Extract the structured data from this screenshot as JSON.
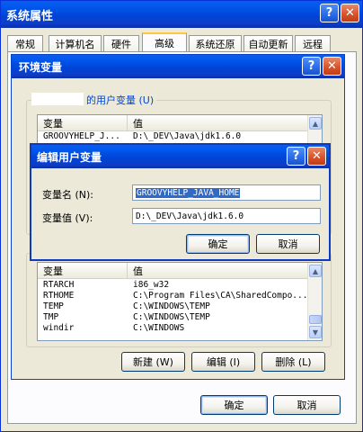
{
  "sysprops": {
    "title": "系统属性",
    "tabs": [
      "常规",
      "计算机名",
      "硬件",
      "高级",
      "系统还原",
      "自动更新",
      "远程"
    ],
    "ok_label": "确定",
    "cancel_label": "取消"
  },
  "envvars": {
    "title": "环境变量",
    "user_section_label": "的用户变量 (U)",
    "columns": [
      "变量",
      "值"
    ],
    "user_vars": [
      {
        "name": "GROOVYHELP_J...",
        "value": "D:\\_DEV\\Java\\jdk1.6.0"
      }
    ],
    "system_vars": [
      {
        "name": "RTARCH",
        "value": "i86_w32"
      },
      {
        "name": "RTHOME",
        "value": "C:\\Program Files\\CA\\SharedCompo..."
      },
      {
        "name": "TEMP",
        "value": "C:\\WINDOWS\\TEMP"
      },
      {
        "name": "TMP",
        "value": "C:\\WINDOWS\\TEMP"
      },
      {
        "name": "windir",
        "value": "C:\\WINDOWS"
      }
    ],
    "new_label": "新建 (W)",
    "edit_label": "编辑 (I)",
    "delete_label": "删除 (L)"
  },
  "editdlg": {
    "title": "编辑用户变量",
    "name_label": "变量名 (N):",
    "value_label": "变量值 (V):",
    "name_value": "GROOVYHELP_JAVA_HOME",
    "value_value": "D:\\_DEV\\Java\\jdk1.6.0",
    "ok_label": "确定",
    "cancel_label": "取消"
  },
  "icons": {
    "help": "?",
    "close": "✕"
  },
  "colors": {
    "titlebar": "#0054e3",
    "selection": "#316ac5",
    "dialog_bg": "#ece9d8"
  }
}
